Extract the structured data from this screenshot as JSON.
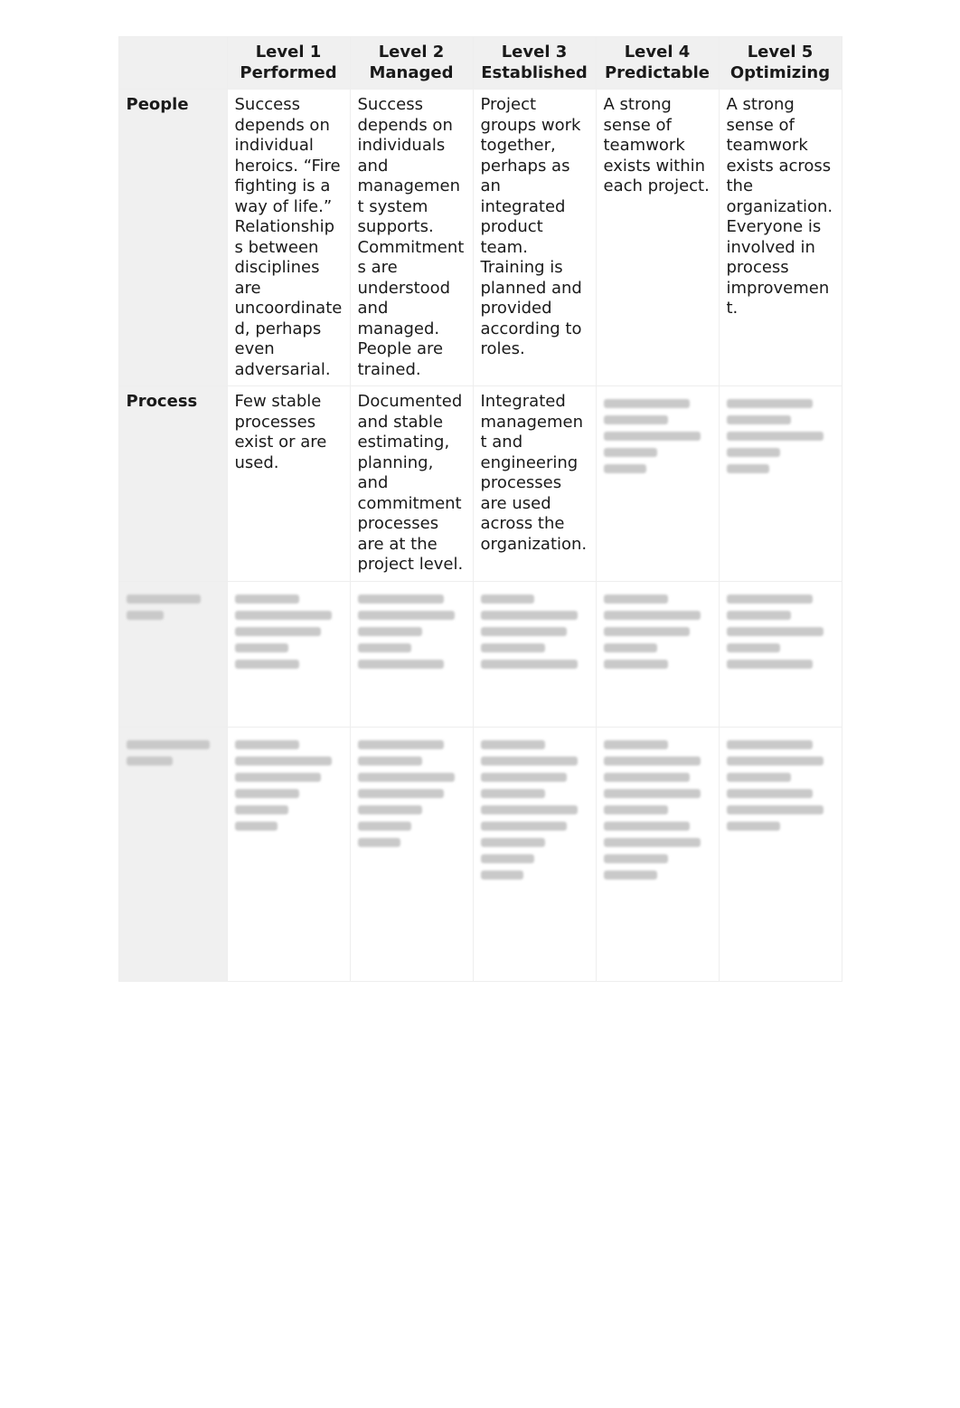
{
  "table": {
    "corner": "",
    "columns": [
      "Level 1 Performed",
      "Level 2 Managed",
      "Level 3 Established",
      "Level 4 Predictable",
      "Level 5 Optimizing"
    ],
    "rows": [
      {
        "label": "People",
        "cells": [
          "Success depends on individual heroics. “Fire fighting is a way of life.” Relationships between disciplines are uncoordinated, perhaps even adversarial.",
          "Success depends on individuals and management system supports. Commitments are understood and managed. People are trained.",
          "Project groups work together, perhaps as an integrated product team. Training is planned and provided according to roles.",
          "A strong sense of teamwork exists within each project.",
          "A strong sense of teamwork exists across the organization. Everyone is involved in process improvement."
        ]
      },
      {
        "label": "Process",
        "cells": [
          "Few stable processes exist or are used.",
          "Documented and stable estimating, planning, and commitment processes are at the project level.",
          "Integrated management and engineering processes are used across the organization.",
          "",
          ""
        ]
      },
      {
        "label": "",
        "cells": [
          "",
          "",
          "",
          "",
          ""
        ]
      },
      {
        "label": "",
        "cells": [
          "",
          "",
          "",
          "",
          ""
        ]
      }
    ]
  }
}
